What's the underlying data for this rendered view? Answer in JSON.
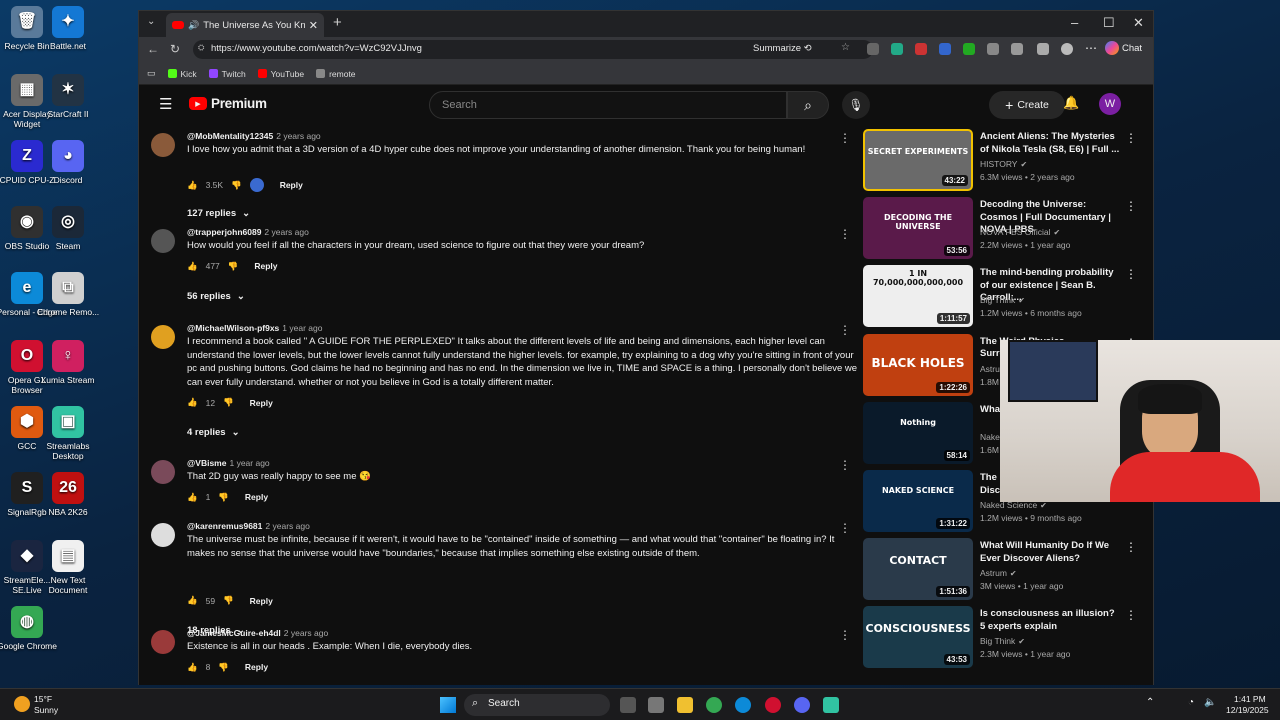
{
  "desktop": {
    "icons": [
      {
        "label": "Recycle Bin",
        "glyph": "🗑",
        "color": "#5a7a9a"
      },
      {
        "label": "Battle.net",
        "glyph": "✦",
        "color": "#1478d4"
      },
      {
        "label": "Acer Display Widget",
        "glyph": "▦",
        "color": "#6a6a6a"
      },
      {
        "label": "StarCraft II",
        "glyph": "✶",
        "color": "#234"
      },
      {
        "label": "CPUID CPU-Z",
        "glyph": "Z",
        "color": "#2a2ad0"
      },
      {
        "label": "Discord",
        "glyph": "◕",
        "color": "#5865f2"
      },
      {
        "label": "OBS Studio",
        "glyph": "◉",
        "color": "#303030"
      },
      {
        "label": "Steam",
        "glyph": "◎",
        "color": "#1b2838"
      },
      {
        "label": "Personal - Edge",
        "glyph": "e",
        "color": "#0c8ad8"
      },
      {
        "label": "Chrome Remo...",
        "glyph": "⧉",
        "color": "#d0d0d0"
      },
      {
        "label": "Opera GX Browser",
        "glyph": "O",
        "color": "#d01030"
      },
      {
        "label": "Lumia Stream",
        "glyph": "♀",
        "color": "#d02060"
      },
      {
        "label": "GCC",
        "glyph": "⬢",
        "color": "#e05a10"
      },
      {
        "label": "Streamlabs Desktop",
        "glyph": "▣",
        "color": "#31c3a2"
      },
      {
        "label": "SignalRgb",
        "glyph": "S",
        "color": "#202020"
      },
      {
        "label": "NBA 2K26",
        "glyph": "26",
        "color": "#c01010"
      },
      {
        "label": "StreamEle... SE.Live",
        "glyph": "◆",
        "color": "#1a2540"
      },
      {
        "label": "New Text Document",
        "glyph": "▤",
        "color": "#f0f0f0"
      },
      {
        "label": "Google Chrome",
        "glyph": "◍",
        "color": "#34a853"
      }
    ]
  },
  "browser": {
    "tab_title": "The Universe As You Know It I",
    "url": "https://www.youtube.com/watch?v=WzC92VJJnvg",
    "summarize": "Summarize",
    "chat": "Chat",
    "bookmarks": [
      {
        "label": "Kick",
        "color": "#53fc18"
      },
      {
        "label": "Twitch",
        "color": "#9146ff"
      },
      {
        "label": "YouTube",
        "color": "#ff0000"
      },
      {
        "label": "remote",
        "color": "#888888"
      }
    ]
  },
  "youtube": {
    "logo": "Premium",
    "search_placeholder": "Search",
    "create": "Create",
    "avatar_letter": "W",
    "comments": [
      {
        "author": "@MobMentality12345",
        "time": "2 years ago",
        "text": "I love how you admit that a 3D version of a 4D hyper cube does not improve your understanding of another dimension. Thank you for being human!",
        "likes": "3.5K",
        "reply": "Reply",
        "replies": "127 replies",
        "avatar": "#8a5a3a"
      },
      {
        "author": "@trapperjohn6089",
        "time": "2 years ago",
        "text": "How would you feel if all the characters in your dream, used science to figure out that they were your dream?",
        "likes": "477",
        "reply": "Reply",
        "replies": "56 replies",
        "avatar": "#555555"
      },
      {
        "author": "@MichaelWilson-pf9xs",
        "time": "1 year ago",
        "text": "I recommend a book called \" A GUIDE FOR THE PERPLEXED\" It talks about the different levels of life and being and dimensions, each higher level can understand the lower levels, but the lower levels cannot fully understand the higher levels.  for example, try explaining to a dog why you're sitting in front of your pc and pushing buttons.  God claims he had no beginning and has no end. In the dimension we live in, TIME and SPACE is a thing. I personally don't believe we can ever fully understand. whether or not you believe in God is a totally different matter.",
        "likes": "12",
        "reply": "Reply",
        "replies": "4 replies",
        "avatar": "#e0a020"
      },
      {
        "author": "@VBisme",
        "time": "1 year ago",
        "text": "That 2D guy was really happy to see me 😘",
        "likes": "1",
        "reply": "Reply",
        "replies": "",
        "avatar": "#7a4a5a"
      },
      {
        "author": "@karenremus9681",
        "time": "2 years ago",
        "text": "The universe must be infinite, because if it weren't, it would have to be \"contained\" inside of something — and what would that \"container\" be floating in? It makes no sense that the universe would have \"boundaries,\" because that implies something else existing  outside of them.",
        "likes": "59",
        "reply": "Reply",
        "replies": "18 replies",
        "avatar": "#dddddd"
      },
      {
        "author": "@JamesMcGuire-eh4dl",
        "time": "2 years ago",
        "text": "Existence is all in our heads . Example: When I die, everybody dies.",
        "likes": "8",
        "reply": "Reply",
        "replies": "",
        "avatar": "#9a3a3a"
      }
    ],
    "related": [
      {
        "title": "Ancient Aliens: The Mysteries of Nikola Tesla (S8, E6) | Full ...",
        "channel": "HISTORY",
        "meta": "6.3M views • 2 years ago",
        "duration": "43:22",
        "thumb_text": "SECRET EXPERIMENTS",
        "bg": "#6a6a6a"
      },
      {
        "title": "Decoding the Universe: Cosmos | Full Documentary | NOVA | PBS",
        "channel": "NOVA PBS Official",
        "meta": "2.2M views • 1 year ago",
        "duration": "53:56",
        "thumb_text": "DECODING THE UNIVERSE",
        "bg": "#5a1a4a"
      },
      {
        "title": "The mind-bending probability of our existence | Sean B. Carroll:...",
        "channel": "Big Think",
        "meta": "1.2M views • 6 months ago",
        "duration": "1:11:57",
        "thumb_text": "1 IN 70,000,000,000,000",
        "bg": "#eeeeee"
      },
      {
        "title": "The Weird Physics Surrounding Black Holes",
        "channel": "Astrum",
        "meta": "1.8M views",
        "duration": "1:22:26",
        "thumb_text": "BLACK HOLES",
        "bg": "#c04010"
      },
      {
        "title": "What Is The Void",
        "channel": "Naked Science",
        "meta": "1.6M views",
        "duration": "58:14",
        "thumb_text": "Nothing",
        "bg": "#0a1a2a"
      },
      {
        "title": "The Most Incredible Space Discoveries FULL",
        "channel": "Naked Science",
        "meta": "1.2M views • 9 months ago",
        "duration": "1:31:22",
        "thumb_text": "NAKED SCIENCE",
        "bg": "#0a2a4a"
      },
      {
        "title": "What Will Humanity Do If We Ever Discover Aliens?",
        "channel": "Astrum",
        "meta": "3M views • 1 year ago",
        "duration": "1:51:36",
        "thumb_text": "CONTACT",
        "bg": "#2a3a4a"
      },
      {
        "title": "Is consciousness an illusion? 5 experts explain",
        "channel": "Big Think",
        "meta": "2.3M views • 1 year ago",
        "duration": "43:53",
        "thumb_text": "CONSCIOUSNESS",
        "bg": "#1a3a4a"
      }
    ]
  },
  "taskbar": {
    "weather_temp": "15°F",
    "weather_desc": "Sunny",
    "search": "Search",
    "time": "1:41 PM",
    "date": "12/19/2025"
  }
}
